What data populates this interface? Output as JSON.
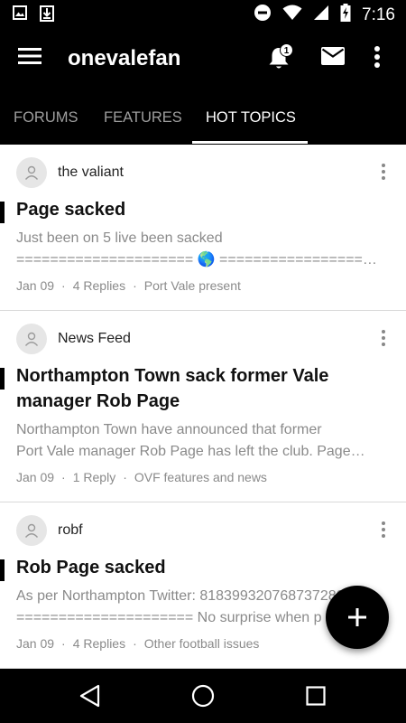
{
  "status_bar": {
    "time": "7:16"
  },
  "app_bar": {
    "title": "onevalefan",
    "notification_count": "1"
  },
  "tabs": [
    {
      "label": "FORUMS",
      "active": false
    },
    {
      "label": "FEATURES",
      "active": false
    },
    {
      "label": "HOT TOPICS",
      "active": true
    }
  ],
  "topics": [
    {
      "author": "the valiant",
      "title": "Page sacked",
      "snippet_1": "Just been on 5 live been sacked",
      "snippet_2": "===================== 🌎 =================…",
      "date": "Jan 09",
      "replies": "4 Replies",
      "forum": "Port Vale present"
    },
    {
      "author": "News Feed",
      "title": "Northampton Town sack former Vale manager Rob Page",
      "snippet_1": "Northampton Town have announced that former",
      "snippet_2": "Port Vale manager Rob Page has left the club. Page…",
      "date": "Jan 09",
      "replies": "1 Reply",
      "forum": "OVF features and news"
    },
    {
      "author": "robf",
      "title": "Rob Page sacked",
      "snippet_1": "As per Northampton Twitter: 818399320768737280",
      "snippet_2": "===================== No surprise when p",
      "date": "Jan 09",
      "replies": "4 Replies",
      "forum": "Other football issues"
    }
  ],
  "icons": {
    "status": [
      "image-icon",
      "download-icon",
      "do-not-disturb-icon",
      "wifi-icon",
      "signal-icon",
      "battery-charging-icon"
    ],
    "app_bar": [
      "menu-icon",
      "bell-icon",
      "mail-icon",
      "more-vert-icon"
    ],
    "fab": "plus-icon",
    "nav": [
      "back-icon",
      "home-icon",
      "recents-icon"
    ]
  }
}
